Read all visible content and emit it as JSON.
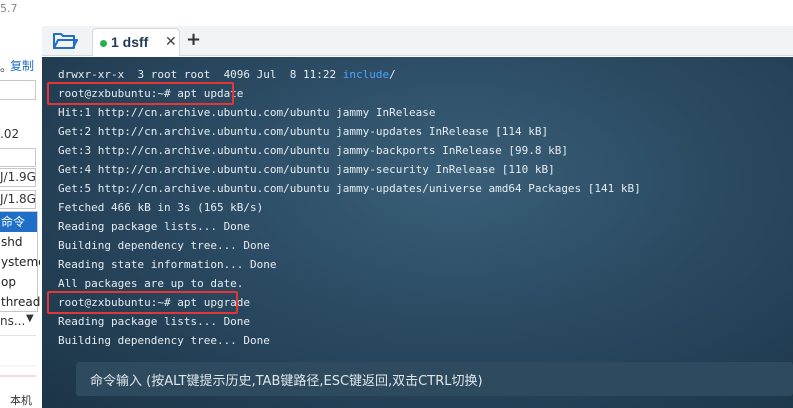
{
  "left_panel": {
    "version": "5.7",
    "copy_label": "复制",
    "copy_prefix": "。",
    "value_02": ".02",
    "mem_1": "J/1.9G",
    "mem_2": "J/1.8G",
    "process_list": [
      {
        "label": "命令",
        "selected": true
      },
      {
        "label": "shd",
        "selected": false
      },
      {
        "label": "ystemd",
        "selected": false
      },
      {
        "label": "op",
        "selected": false
      },
      {
        "label": "threadd",
        "selected": false
      }
    ],
    "dropdown_label": "ns...",
    "footer_label": "本机"
  },
  "tabbar": {
    "tab_label": "1 dsff",
    "close_glyph": "✕",
    "add_glyph": "+"
  },
  "terminal": {
    "lines": [
      {
        "text": "drwxr-xr-x  3 root root  4096 Jul  8 11:22 ",
        "dir": "include",
        "suffix": "/"
      },
      {
        "text": "root@zxbubuntu:~# apt update"
      },
      {
        "text": "Hit:1 http://cn.archive.ubuntu.com/ubuntu jammy InRelease"
      },
      {
        "text": "Get:2 http://cn.archive.ubuntu.com/ubuntu jammy-updates InRelease [114 kB]"
      },
      {
        "text": "Get:3 http://cn.archive.ubuntu.com/ubuntu jammy-backports InRelease [99.8 kB]"
      },
      {
        "text": "Get:4 http://cn.archive.ubuntu.com/ubuntu jammy-security InRelease [110 kB]"
      },
      {
        "text": "Get:5 http://cn.archive.ubuntu.com/ubuntu jammy-updates/universe amd64 Packages [141 kB]"
      },
      {
        "text": "Fetched 466 kB in 3s (165 kB/s)"
      },
      {
        "text": "Reading package lists... Done"
      },
      {
        "text": "Building dependency tree... Done"
      },
      {
        "text": "Reading state information... Done"
      },
      {
        "text": "All packages are up to date."
      },
      {
        "text": "root@zxbubuntu:~# apt upgrade"
      },
      {
        "text": "Reading package lists... Done"
      },
      {
        "text": "Building dependency tree... Done"
      }
    ],
    "command_bar_label": "命令输入 (按ALT键提示历史,TAB键路径,ESC键返回,双击CTRL切换)",
    "highlight_color": "#e53535",
    "directory_color": "#4aa3ff"
  }
}
